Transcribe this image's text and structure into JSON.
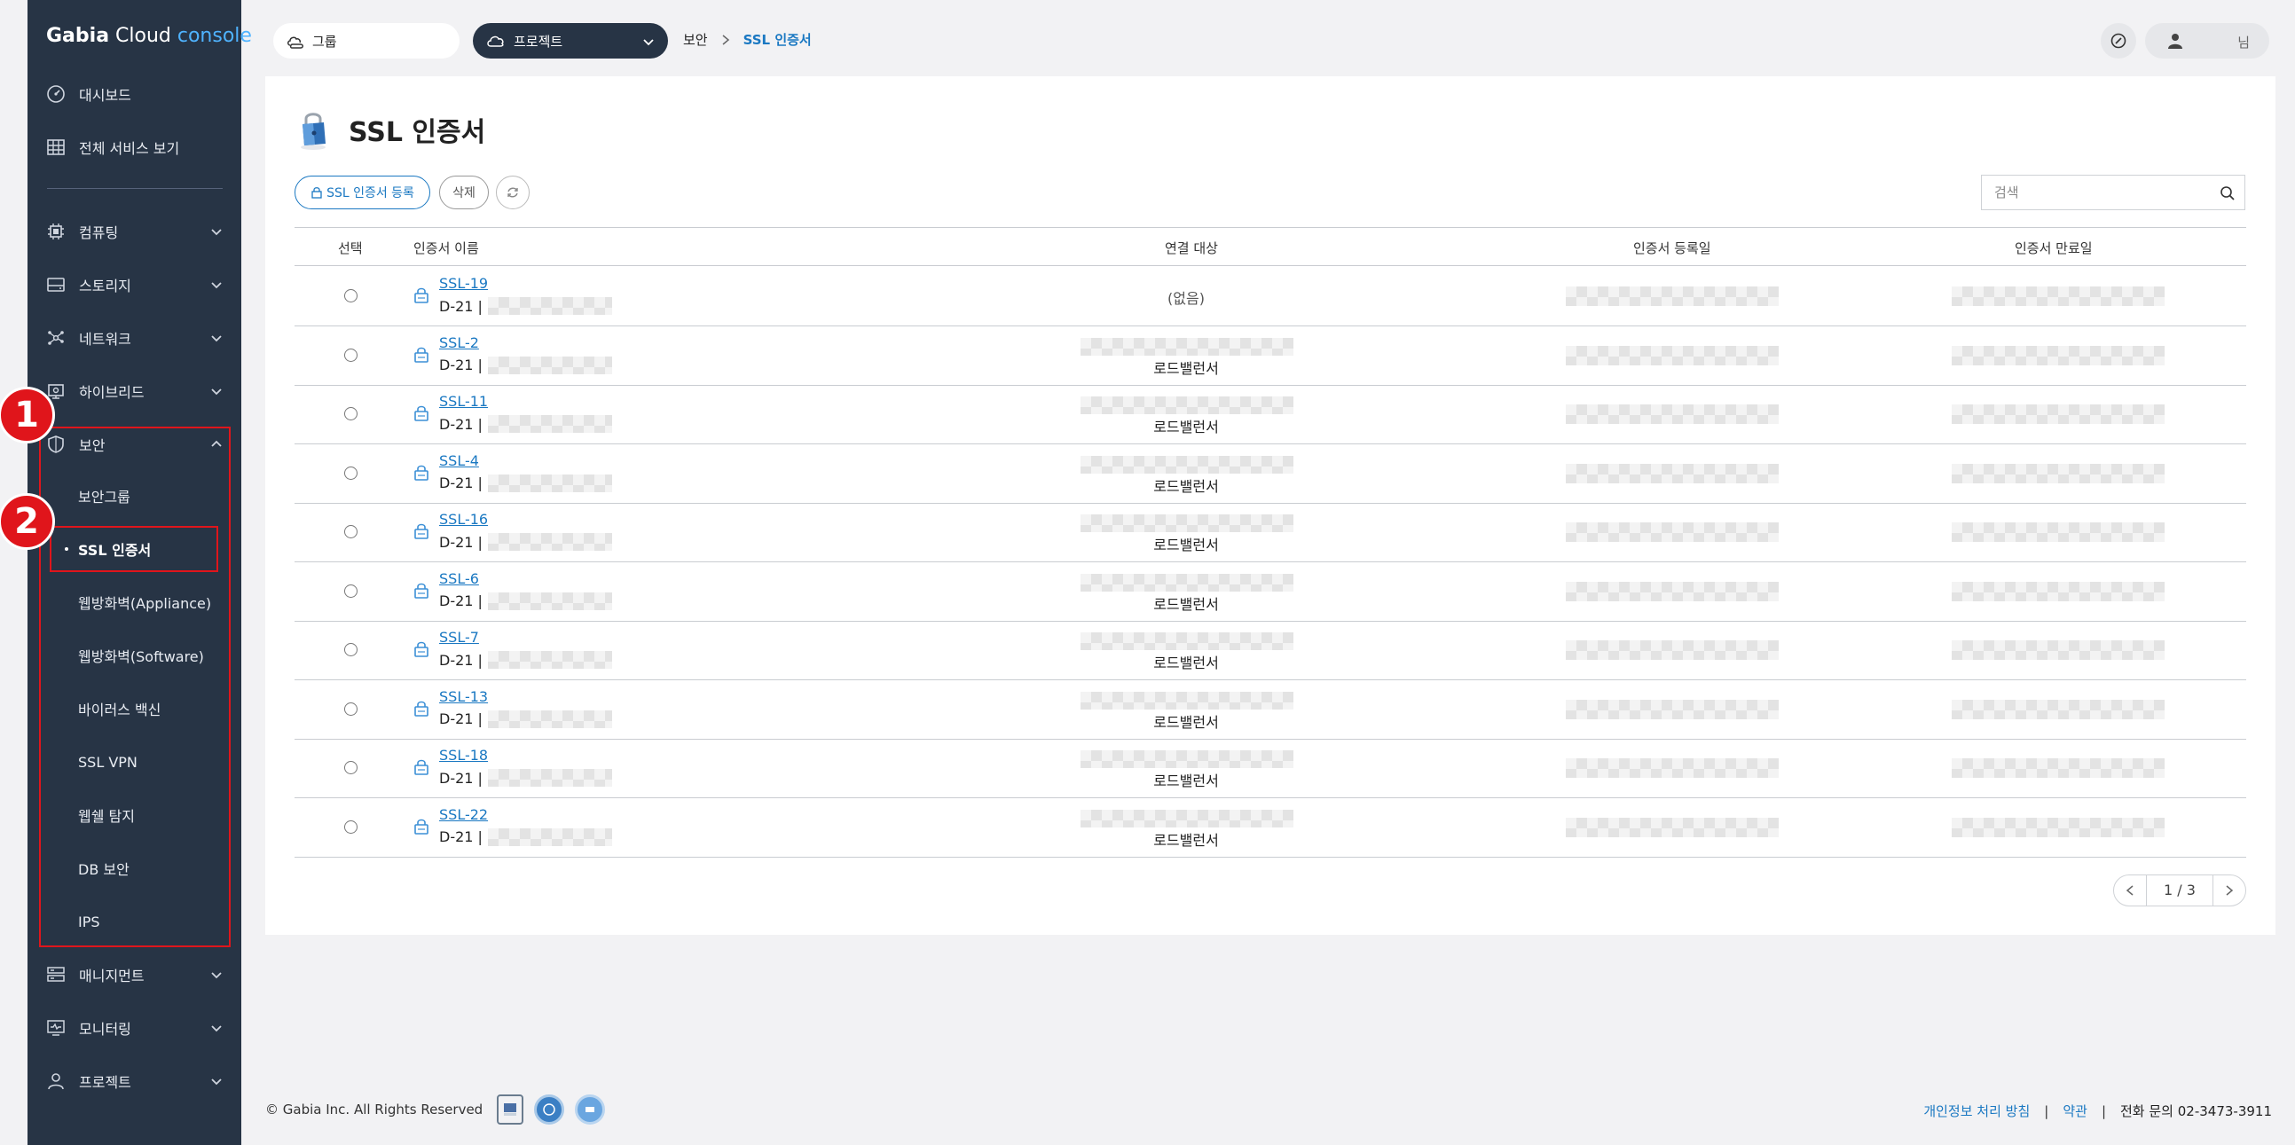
{
  "app": {
    "logo_brand": "Gabia",
    "logo_mid": " Cloud ",
    "logo_console": "console"
  },
  "sidebar": {
    "dashboard": "대시보드",
    "all_services": "전체 서비스 보기",
    "items": [
      {
        "label": "컴퓨팅",
        "icon": "chip-icon"
      },
      {
        "label": "스토리지",
        "icon": "storage-icon"
      },
      {
        "label": "네트워크",
        "icon": "network-icon"
      },
      {
        "label": "하이브리드",
        "icon": "hybrid-icon"
      },
      {
        "label": "보안",
        "icon": "shield-icon"
      }
    ],
    "security_sub": [
      "보안그룹",
      "SSL 인증서",
      "웹방화벽(Appliance)",
      "웹방화벽(Software)",
      "바이러스 백신",
      "SSL VPN",
      "웹쉘 탐지",
      "DB 보안",
      "IPS"
    ],
    "bottom_items": [
      {
        "label": "매니지먼트",
        "icon": "management-icon"
      },
      {
        "label": "모니터링",
        "icon": "monitoring-icon"
      },
      {
        "label": "프로젝트",
        "icon": "person-icon"
      }
    ]
  },
  "annotations": {
    "badge1": "1",
    "badge2": "2"
  },
  "topbar": {
    "group_label": "그룹",
    "project_label": "프로젝트",
    "breadcrumb_parent": "보안",
    "breadcrumb_current": "SSL 인증서",
    "user_suffix": "님"
  },
  "page": {
    "title": "SSL 인증서",
    "register_button": "SSL 인증서 등록",
    "delete_button": "삭제",
    "search_placeholder": "검색"
  },
  "table": {
    "headers": {
      "select": "선택",
      "name": "인증서 이름",
      "target": "연결 대상",
      "registered": "인증서 등록일",
      "expires": "인증서 만료일"
    },
    "rows": [
      {
        "name": "SSL-19",
        "dday": "D-21 |",
        "target": "(없음)"
      },
      {
        "name": "SSL-2",
        "dday": "D-21 |",
        "target": "로드밸런서"
      },
      {
        "name": "SSL-11",
        "dday": "D-21 |",
        "target": "로드밸런서"
      },
      {
        "name": "SSL-4",
        "dday": "D-21 |",
        "target": "로드밸런서"
      },
      {
        "name": "SSL-16",
        "dday": "D-21 |",
        "target": "로드밸런서"
      },
      {
        "name": "SSL-6",
        "dday": "D-21 |",
        "target": "로드밸런서"
      },
      {
        "name": "SSL-7",
        "dday": "D-21 |",
        "target": "로드밸런서"
      },
      {
        "name": "SSL-13",
        "dday": "D-21 |",
        "target": "로드밸런서"
      },
      {
        "name": "SSL-18",
        "dday": "D-21 |",
        "target": "로드밸런서"
      },
      {
        "name": "SSL-22",
        "dday": "D-21 |",
        "target": "로드밸런서"
      }
    ]
  },
  "pagination": {
    "text": "1  /  3"
  },
  "footer": {
    "copyright": "© Gabia Inc. All Rights Reserved",
    "privacy": "개인정보 처리 방침",
    "terms": "약관",
    "phone": "전화 문의 02-3473-3911"
  },
  "colors": {
    "sidebar_bg": "#273445",
    "accent": "#1a78c2",
    "annotation_red": "#e0151b"
  }
}
